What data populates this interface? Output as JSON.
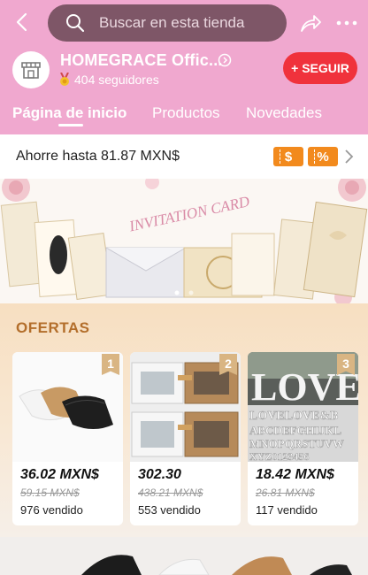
{
  "header": {
    "search_placeholder": "Buscar en esta tienda",
    "store_name": "HOMEGRACE Offic...",
    "followers": "404 seguidores",
    "follow_label": "+ SEGUIR",
    "bg_color": "#f0a8cf"
  },
  "tabs": [
    {
      "label": "Página de inicio",
      "active": true
    },
    {
      "label": "Productos",
      "active": false
    },
    {
      "label": "Novedades",
      "active": false
    }
  ],
  "savings": {
    "text": "Ahorre hasta 81.87 MXN$",
    "coupon1": "$",
    "coupon2": "%"
  },
  "banner": {
    "title": "INVITATION CARD"
  },
  "ofertas": {
    "title": "OFERTAS",
    "products": [
      {
        "rank": "1",
        "price": "36.02 MXN$",
        "old_price": "59.15 MXN$",
        "sold": "976 vendido"
      },
      {
        "rank": "2",
        "price": "302.30",
        "old_price": "438.21 MXN$",
        "sold": "553 vendido"
      },
      {
        "rank": "3",
        "price": "18.42 MXN$",
        "old_price": "26.81 MXN$",
        "sold": "117 vendido"
      }
    ]
  },
  "colors": {
    "accent": "#f0323c",
    "coupon": "#f28a1d",
    "ofertas_title": "#b36e2b"
  }
}
